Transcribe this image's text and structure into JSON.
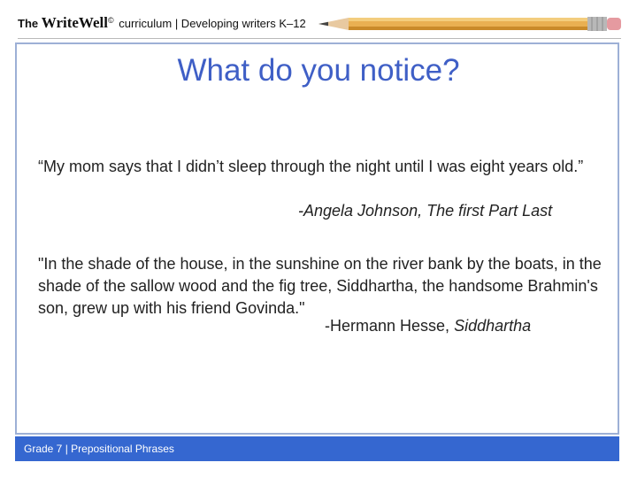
{
  "header": {
    "brand_prefix": "The",
    "brand_name": "WriteWell",
    "brand_mark": "©",
    "brand_tagline": "curriculum | Developing writers K–12",
    "decoration": "pencil-icon"
  },
  "slide": {
    "title": "What do you notice?",
    "quote1": {
      "text": "“My mom says that I didn’t sleep through the night until I was eight years old.”",
      "attribution": "-Angela Johnson, The first Part Last"
    },
    "quote2": {
      "text": "\"In the shade of the house, in the sunshine on the river bank by the boats, in the shade of the sallow wood and the fig tree, Siddhartha, the handsome Brahmin's son, grew up with his friend Govinda.\"",
      "attribution_author": "-Hermann Hesse,",
      "attribution_book": "Siddhartha"
    }
  },
  "footer": {
    "label": "Grade 7 | Prepositional Phrases"
  },
  "colors": {
    "title": "#3f5fc6",
    "frame_border": "#9db0d6",
    "footer_bg": "#3567d0"
  }
}
